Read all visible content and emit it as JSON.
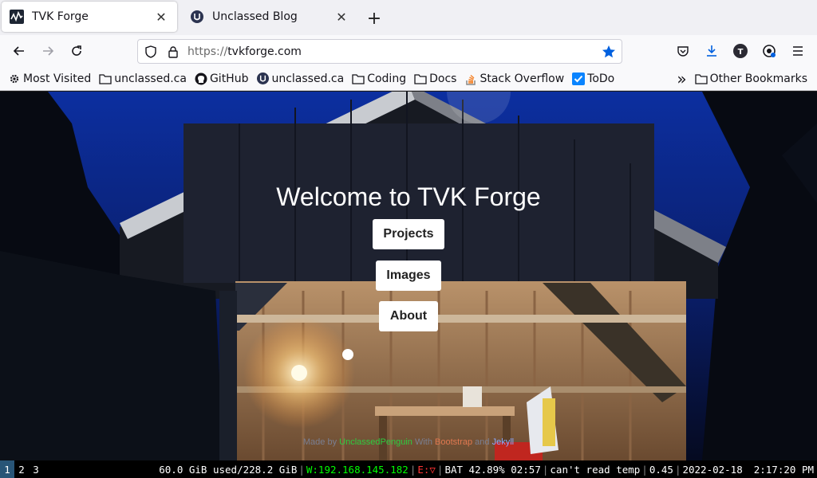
{
  "tabs": [
    {
      "title": "TVK Forge",
      "active": true,
      "favicon": "tvk-forge-icon"
    },
    {
      "title": "Unclassed Blog",
      "active": false,
      "favicon": "unclassed-icon"
    }
  ],
  "nav": {
    "url_scheme": "https://",
    "url_host": "tvkforge.com"
  },
  "bookmarks": {
    "items": [
      {
        "label": "Most Visited",
        "icon": "gear-icon"
      },
      {
        "label": "unclassed.ca",
        "icon": "folder-icon"
      },
      {
        "label": "GitHub",
        "icon": "github-icon"
      },
      {
        "label": "unclassed.ca",
        "icon": "unclassed-icon"
      },
      {
        "label": "Coding",
        "icon": "folder-icon"
      },
      {
        "label": "Docs",
        "icon": "folder-icon"
      },
      {
        "label": "Stack Overflow",
        "icon": "stackoverflow-icon"
      },
      {
        "label": "ToDo",
        "icon": "checkbox-icon"
      }
    ],
    "other": "Other Bookmarks",
    "overflow": "»"
  },
  "page": {
    "heading": "Welcome to TVK Forge",
    "links": [
      "Projects",
      "Images",
      "About"
    ],
    "footer": {
      "prefix": "Made by",
      "author": "UnclassedPenguin",
      "with": "With",
      "framework": "Bootstrap",
      "and": "and",
      "engine": "Jekyll"
    }
  },
  "statusbar": {
    "workspaces": [
      "1",
      "2",
      "3"
    ],
    "disk": "60.0 GiB used/228.2 GiB",
    "wifi": "W:192.168.145.182",
    "ethernet": "E:▽",
    "battery": "BAT 42.89% 02:57",
    "temp": "can't read temp",
    "load": "0.45",
    "date": "2022-02-18",
    "time": "2:17:20 PM"
  },
  "colors": {
    "accent": "#0060df",
    "workspace_active": "#285577",
    "status_green": "#00ff00",
    "status_red": "#ff3333"
  }
}
